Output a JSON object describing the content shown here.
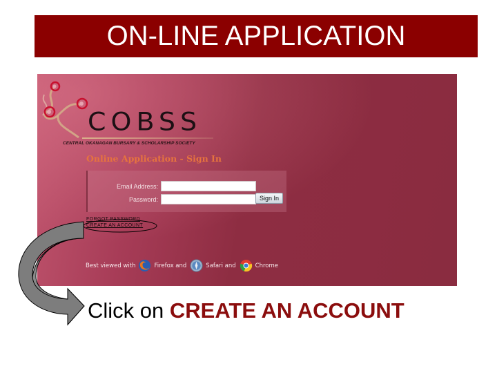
{
  "slide": {
    "title": "ON-LINE APPLICATION",
    "title_bar_color": "#8b0000",
    "instruction_prefix": "Click on ",
    "instruction_emphasis": "CREATE AN ACCOUNT",
    "instruction_emphasis_color": "#8b0d0d"
  },
  "screenshot": {
    "logo": {
      "wordmark": "COBSS",
      "tagline": "CENTRAL OKANAGAN BURSARY & SCHOLARSHIP SOCIETY"
    },
    "heading": "Online Application - Sign In",
    "heading_color": "#e6733e",
    "form": {
      "email_label": "Email Address:",
      "email_value": "",
      "password_label": "Password:",
      "password_value": "",
      "signin_button": "Sign In"
    },
    "links": {
      "forgot_password": "FORGOT PASSWORD",
      "create_account": "CREATE AN ACCOUNT"
    },
    "browsers": {
      "prefix": "Best viewed with",
      "items": [
        {
          "icon": "firefox-icon",
          "label": "Firefox and"
        },
        {
          "icon": "safari-icon",
          "label": "Safari and"
        },
        {
          "icon": "chrome-icon",
          "label": "Chrome"
        }
      ]
    },
    "background_color": "#8e2d42"
  }
}
